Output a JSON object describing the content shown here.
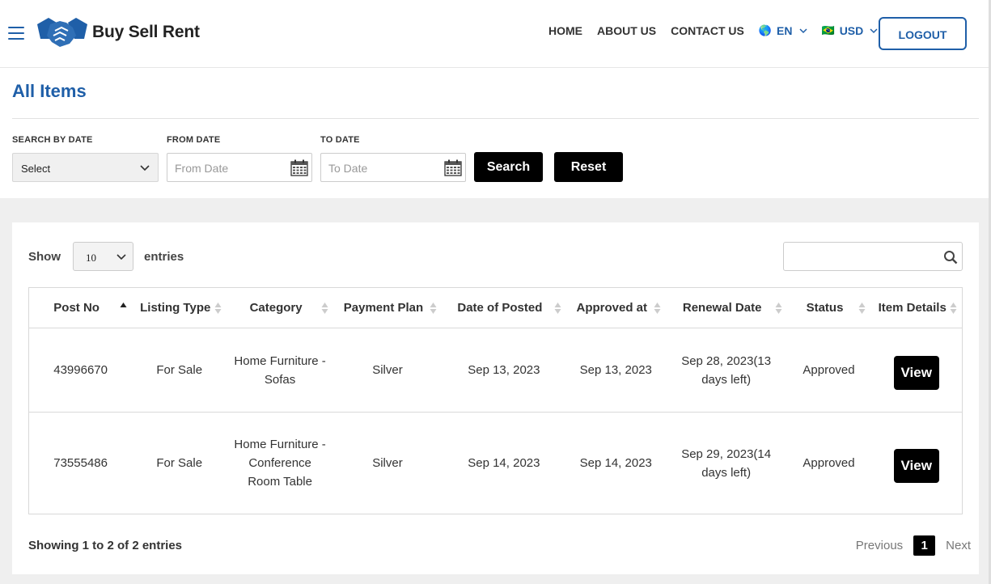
{
  "header": {
    "brand": "Buy Sell Rent",
    "nav": [
      "HOME",
      "ABOUT US",
      "CONTACT US"
    ],
    "language": {
      "flag": "🌎",
      "label": "EN"
    },
    "currency": {
      "flag": "🇧🇷",
      "label": "USD"
    },
    "logout": "LOGOUT"
  },
  "page": {
    "title": "All Items"
  },
  "filters": {
    "search_by_date_label": "SEARCH BY DATE",
    "search_by_date_value": "Select",
    "from_date_label": "FROM DATE",
    "from_date_placeholder": "From Date",
    "to_date_label": "TO DATE",
    "to_date_placeholder": "To Date",
    "search": "Search",
    "reset": "Reset"
  },
  "table_controls": {
    "show": "Show",
    "page_size": "10",
    "entries": "entries"
  },
  "table": {
    "columns": [
      "Post No",
      "Listing Type",
      "Category",
      "Payment Plan",
      "Date of Posted",
      "Approved at",
      "Renewal Date",
      "Status",
      "Item Details"
    ],
    "rows": [
      {
        "post_no": "43996670",
        "listing_type": "For Sale",
        "category": "Home Furniture - Sofas",
        "payment_plan": "Silver",
        "date_posted": "Sep 13, 2023",
        "approved_at": "Sep 13, 2023",
        "renewal_date": "Sep 28, 2023(13 days left)",
        "status": "Approved",
        "details": "View"
      },
      {
        "post_no": "73555486",
        "listing_type": "For Sale",
        "category": "Home Furniture - Conference Room Table",
        "payment_plan": "Silver",
        "date_posted": "Sep 14, 2023",
        "approved_at": "Sep 14, 2023",
        "renewal_date": "Sep 29, 2023(14 days left)",
        "status": "Approved",
        "details": "View"
      }
    ]
  },
  "footer": {
    "showing": "Showing 1 to 2 of 2 entries",
    "previous": "Previous",
    "page": "1",
    "next": "Next"
  },
  "colors": {
    "accent": "#1f5fa8",
    "button": "#000000"
  }
}
